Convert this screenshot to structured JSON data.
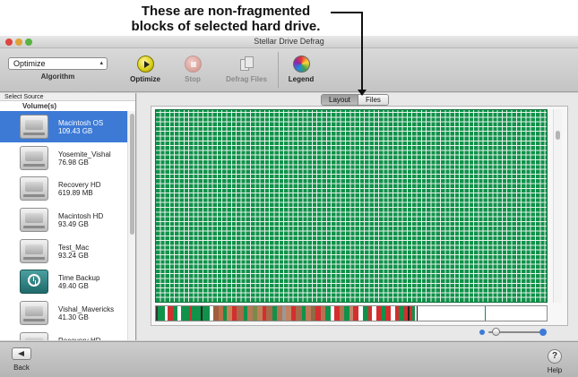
{
  "annotation": {
    "line1": "These are non-fragmented",
    "line2": "blocks of selected hard drive."
  },
  "window": {
    "title": "Stellar Drive Defrag"
  },
  "toolbar": {
    "algorithm_value": "Optimize",
    "algorithm_label": "Algorithm",
    "optimize_label": "Optimize",
    "stop_label": "Stop",
    "defrag_files_label": "Defrag Files",
    "legend_label": "Legend"
  },
  "sidebar": {
    "header": "Select Source",
    "section": "Volume(s)",
    "volumes": [
      {
        "name": "Macintosh OS",
        "size": "109.43 GB",
        "icon": "hard-drive-icon",
        "selected": true
      },
      {
        "name": "Yosemite_Vishal",
        "size": "76.98 GB",
        "icon": "hard-drive-icon"
      },
      {
        "name": "Recovery HD",
        "size": "619.89 MB",
        "icon": "hard-drive-icon"
      },
      {
        "name": "Macintosh HD",
        "size": "93.49 GB",
        "icon": "hard-drive-icon"
      },
      {
        "name": "Test_Mac",
        "size": "93.24 GB",
        "icon": "hard-drive-icon"
      },
      {
        "name": "Time Backup",
        "size": "49.40 GB",
        "icon": "time-machine-icon"
      },
      {
        "name": "Vishal_Mavericks",
        "size": "41.30 GB",
        "icon": "hard-drive-icon"
      },
      {
        "name": "Recovery HD",
        "size": "",
        "icon": "hard-drive-icon"
      }
    ]
  },
  "view_tabs": {
    "layout": "Layout",
    "files": "Files",
    "active": "Layout"
  },
  "colors": {
    "non_fragmented_block": "#10924a",
    "fragmented_block": "#d32f2f",
    "selection": "#3d7ad6"
  },
  "bottom": {
    "back_label": "Back",
    "help_label": "Help",
    "help_glyph": "?"
  }
}
